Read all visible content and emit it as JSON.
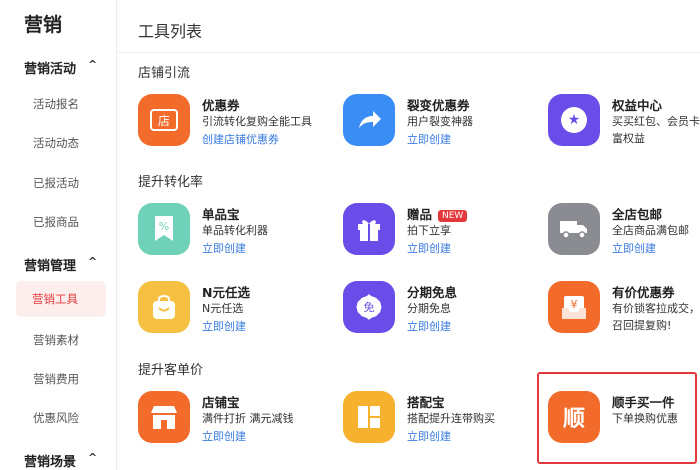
{
  "sidebar": {
    "brand": "营销",
    "sections": [
      {
        "title": "营销活动",
        "chevron": "^",
        "items": [
          "活动报名",
          "活动动态",
          "已报活动",
          "已报商品"
        ]
      },
      {
        "title": "营销管理",
        "chevron": "^",
        "items": [
          "营销工具",
          "营销素材",
          "营销费用",
          "优惠风险"
        ]
      },
      {
        "title": "营销场景",
        "chevron": "^",
        "items": []
      }
    ],
    "active_item": "营销工具"
  },
  "main": {
    "title": "工具列表",
    "groups": [
      {
        "title": "店铺引流",
        "tools": [
          {
            "name": "优惠券",
            "desc": "引流转化复购全能工具",
            "link": "创建店铺优惠券",
            "icon": "coupon-icon",
            "glyph": "店",
            "color": "#f26b2a"
          },
          {
            "name": "裂变优惠券",
            "desc": "用户裂变神器",
            "link": "立即创建",
            "icon": "share-arrow-icon",
            "glyph": "",
            "color": "#3a8df5"
          },
          {
            "name": "权益中心",
            "desc": "买买红包、会员卡",
            "desc2": "富权益",
            "link": "",
            "icon": "star-badge-icon",
            "glyph": "★",
            "color": "#6a4de8"
          }
        ]
      },
      {
        "title": "提升转化率",
        "tools": [
          {
            "name": "单品宝",
            "desc": "单品转化利器",
            "link": "立即创建",
            "icon": "discount-tag-icon",
            "glyph": "%",
            "color": "#6fd2b8"
          },
          {
            "name": "赠品",
            "badge": "NEW",
            "desc": "拍下立享",
            "link": "立即创建",
            "icon": "gift-icon",
            "glyph": "",
            "color": "#6a4de8"
          },
          {
            "name": "全店包邮",
            "desc": "全店商品满包邮",
            "link": "立即创建",
            "icon": "truck-icon",
            "glyph": "",
            "color": "#8a8c91"
          },
          {
            "name": "N元任选",
            "desc": "N元任选",
            "link": "立即创建",
            "icon": "bag-icon",
            "glyph": "",
            "color": "#f6c142"
          },
          {
            "name": "分期免息",
            "desc": "分期免息",
            "link": "立即创建",
            "icon": "installment-icon",
            "glyph": "免",
            "color": "#6a4de8"
          },
          {
            "name": "有价优惠券",
            "desc": "有价锁客拉成交，",
            "desc2": "召回提复购!",
            "link": "",
            "icon": "paid-coupon-icon",
            "glyph": "¥",
            "color": "#f26b2a"
          }
        ]
      },
      {
        "title": "提升客单价",
        "tools": [
          {
            "name": "店铺宝",
            "desc": "满件打折 满元减钱",
            "link": "立即创建",
            "icon": "shop-icon",
            "glyph": "",
            "color": "#f26b2a"
          },
          {
            "name": "搭配宝",
            "desc": "搭配提升连带购买",
            "link": "立即创建",
            "icon": "grid-layout-icon",
            "glyph": "",
            "color": "#f6b22e"
          },
          {
            "name": "顺手买一件",
            "desc": "下单换购优惠",
            "link": "",
            "icon": "shun-icon",
            "glyph": "顺",
            "color": "#f26b2a"
          }
        ]
      }
    ]
  }
}
